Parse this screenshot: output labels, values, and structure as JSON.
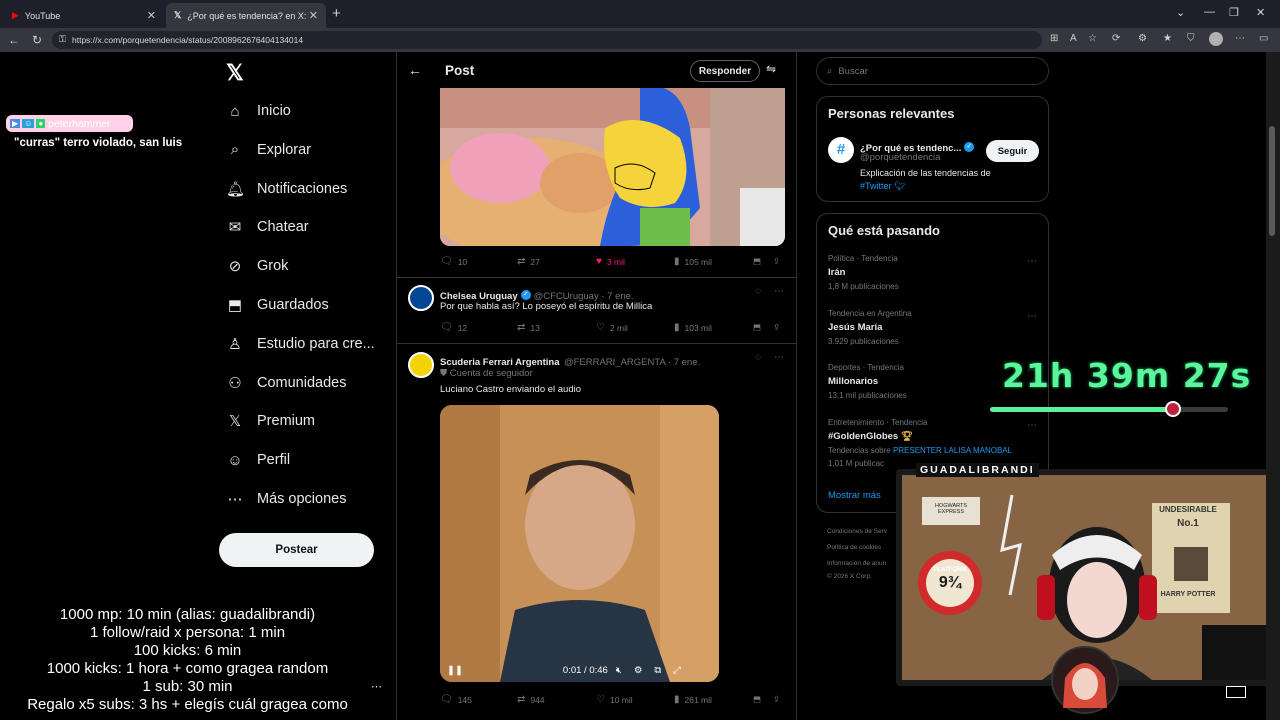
{
  "browser": {
    "tabs": [
      {
        "title": "YouTube",
        "active": false
      },
      {
        "title": "¿Por qué es tendencia? en X: \"\"Lu",
        "active": true
      }
    ],
    "url": "https://x.com/porquetendencia/status/2008962676404134014"
  },
  "x": {
    "nav": [
      {
        "label": "Inicio",
        "icon": "home-icon"
      },
      {
        "label": "Explorar",
        "icon": "search-icon"
      },
      {
        "label": "Notificaciones",
        "icon": "bell-icon"
      },
      {
        "label": "Chatear",
        "icon": "mail-icon"
      },
      {
        "label": "Grok",
        "icon": "grok-icon"
      },
      {
        "label": "Guardados",
        "icon": "bookmark-icon"
      },
      {
        "label": "Estudio para cre...",
        "icon": "creator-icon"
      },
      {
        "label": "Comunidades",
        "icon": "people-icon"
      },
      {
        "label": "Premium",
        "icon": "x-icon"
      },
      {
        "label": "Perfil",
        "icon": "person-icon"
      },
      {
        "label": "Más opciones",
        "icon": "more-icon"
      }
    ],
    "post_button": "Postear",
    "header": {
      "title": "Post",
      "reply": "Responder"
    },
    "first_actions": {
      "replies": "10",
      "reposts": "27",
      "likes": "3 mil",
      "views": "105 mil"
    },
    "replies": [
      {
        "name": "Chelsea Uruguay",
        "handle": "@CFCUruguay · 7 ene.",
        "text": "Por que habla así? Lo poseyó el espíritu de Millica",
        "replies": "12",
        "reposts": "13",
        "likes": "2 mil",
        "views": "103 mil"
      },
      {
        "name": "Scuderia Ferrari Argentina",
        "handle": "@FERRARI_ARGENTA · 7 ene.",
        "badge": "Cuenta de seguidor",
        "text": "Luciano Castro enviando el audio",
        "video_time": "0:01 / 0:46",
        "replies": "145",
        "reposts": "944",
        "likes": "10 mil",
        "views": "261 mil"
      }
    ],
    "search_placeholder": "Buscar",
    "relevant": {
      "title": "Personas relevantes",
      "name": "¿Por qué es tendenc...",
      "handle": "@porquetendencia",
      "follow": "Seguir",
      "bio": "Explicación de las tendencias de",
      "bio_tag": "#Twitter"
    },
    "trends": {
      "title": "Qué está pasando",
      "items": [
        {
          "meta": "Política · Tendencia",
          "name": "Irán",
          "count": "1,8 M publicaciones"
        },
        {
          "meta": "Tendencia en Argentina",
          "name": "Jesús María",
          "count": "3.929 publicaciones"
        },
        {
          "meta": "Deportes · Tendencia",
          "name": "Millonarios",
          "count": "13,1 mil publicaciones"
        },
        {
          "meta": "Entretenimiento · Tendencia",
          "name": "#GoldenGlobes",
          "count": "1,01 M publicac",
          "extra_prefix": "Tendencias sobre",
          "extra_link": "PRESENTER LALISA MANOBAL"
        }
      ],
      "show_more": "Mostrar más"
    },
    "footer": [
      "Condiciones de Serv",
      "Política de cookies",
      "Información de anun",
      "© 2026 X Corp."
    ]
  },
  "stream": {
    "chat_user": "peterhammer",
    "chat_message": "\"curras\" terro violado, san luis",
    "rules": [
      "1000 mp: 10 min (alias: guadalibrandi)",
      "1 follow/raid x persona: 1 min",
      "100 kicks: 6 min",
      "1000 kicks: 1 hora + como gragea random",
      "1 sub: 30 min",
      "Regalo x5 subs: 3 hs + elegís cuál gragea como"
    ],
    "timer": "21h 39m 27s",
    "timer_progress": 0.77,
    "cam_label": "GUADALIBRANDI",
    "poster_title": "UNDESIRABLE",
    "poster_no": "No.1",
    "poster_name": "HARRY POTTER",
    "platform_label": "PLATFORM",
    "platform_num": "9¾",
    "express_label": "HOGWARTS EXPRESS"
  },
  "colors": {
    "accent": "#1d9bf0",
    "like": "#f91880",
    "timer": "#5bf59a"
  }
}
